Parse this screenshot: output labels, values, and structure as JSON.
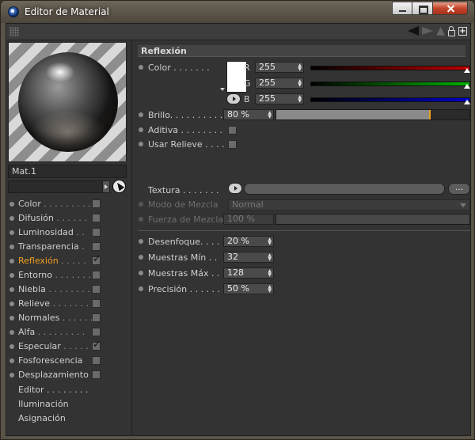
{
  "window": {
    "title": "Editor de Material",
    "icon": "cinema4d-logo-icon",
    "buttons": [
      "minimize-button",
      "maximize-button",
      "close-button"
    ]
  },
  "toolbar": {
    "icons": [
      "grip-icon",
      "back-arrow-icon",
      "forward-arrow-icon",
      "star-icon",
      "lock-icon",
      "new-window-icon"
    ]
  },
  "material": {
    "name": "Mat.1"
  },
  "channels": [
    {
      "label": "Color",
      "dots": " . . . . . . . . .",
      "checked": false,
      "active": false
    },
    {
      "label": "Difusión",
      "dots": " . . . . . .",
      "checked": false,
      "active": false
    },
    {
      "label": "Luminosidad",
      "dots": " . .",
      "checked": false,
      "active": false
    },
    {
      "label": "Transparencia",
      "dots": " .",
      "checked": false,
      "active": false
    },
    {
      "label": "Reflexión",
      "dots": " . . . . .",
      "checked": true,
      "active": true
    },
    {
      "label": "Entorno",
      "dots": " . . . . . . .",
      "checked": false,
      "active": false
    },
    {
      "label": "Niebla",
      "dots": " . . . . . . . .",
      "checked": false,
      "active": false
    },
    {
      "label": "Relieve",
      "dots": " . . . . . . .",
      "checked": false,
      "active": false
    },
    {
      "label": "Normales",
      "dots": " . . . . . .",
      "checked": false,
      "active": false
    },
    {
      "label": "Alfa",
      "dots": " . . . . . . . . .",
      "checked": false,
      "active": false
    },
    {
      "label": "Especular",
      "dots": " . . . . .",
      "checked": true,
      "active": false
    },
    {
      "label": "Fosforescencia",
      "dots": "",
      "checked": false,
      "active": false
    },
    {
      "label": "Desplazamiento",
      "dots": "",
      "checked": false,
      "active": false
    }
  ],
  "extra_items": [
    "Editor . . . . . . . .",
    "Iluminación",
    "Asignación"
  ],
  "reflexion": {
    "header": "Reflexión",
    "color_label": "Color . . . . . . .",
    "swatch_color": "#ffffff",
    "r_label": "R",
    "r_value": "255",
    "g_label": "G",
    "g_value": "255",
    "b_label": "B",
    "b_value": "255",
    "brillo_label": "Brillo. . . . . . . . . .",
    "brillo_value": "80 %",
    "brillo_fraction": 0.8,
    "aditiva_label": "Aditiva . . . . . . . .",
    "relieve_label": "Usar Relieve . . . .",
    "textura_label": "Textura . . . . . . .",
    "textura_button": "...",
    "modo_label": "Modo de Mezcla",
    "modo_value": "Normal",
    "fuerza_label": "Fuerza de Mezcla",
    "fuerza_value": "100 %",
    "desenfoque_label": "Desenfoque. . . .",
    "desenfoque_value": "20 %",
    "muestras_min_label": "Muestras Mín . .",
    "muestras_min_value": "32",
    "muestras_max_label": "Muestras Máx . .",
    "muestras_max_value": "128",
    "precision_label": "Precisión . . . . . .",
    "precision_value": "50 %"
  },
  "colors": {
    "active_channel": "#f0a020",
    "red_bar": "#c00000",
    "green_bar": "#00b000",
    "blue_bar": "#0000c8"
  }
}
